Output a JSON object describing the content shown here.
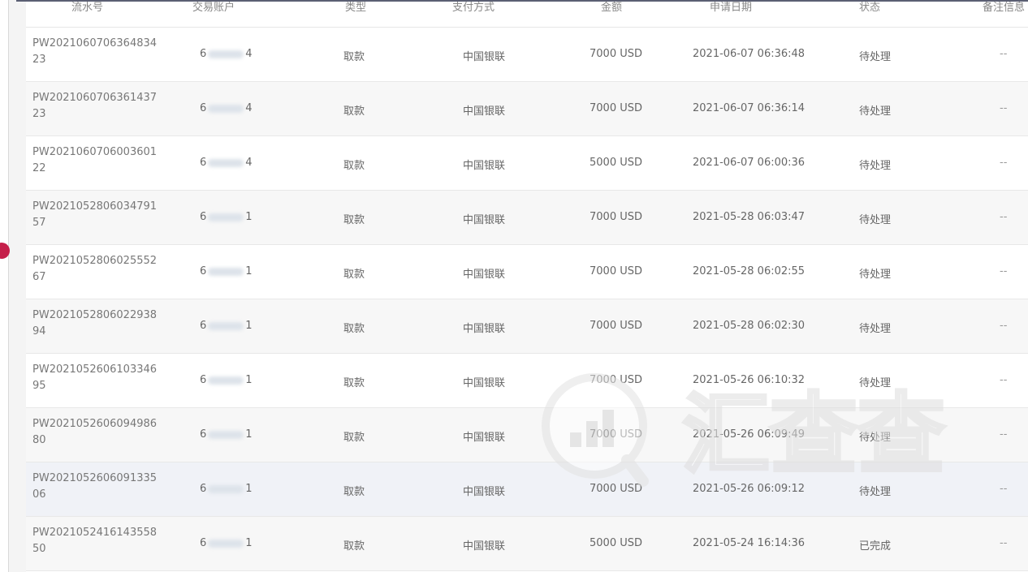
{
  "table": {
    "headers": [
      "流水号",
      "交易账户",
      "类型",
      "支付方式",
      "金额",
      "申请日期",
      "状态",
      "备注信息"
    ],
    "rows": [
      {
        "id": "PW202106070636483423",
        "acc_first": "6",
        "acc_last": "4",
        "type": "取款",
        "channel": "中国银联",
        "amount": "7000 USD",
        "time": "2021-06-07 06:36:48",
        "status": "待处理",
        "note": "--"
      },
      {
        "id": "PW202106070636143723",
        "acc_first": "6",
        "acc_last": "4",
        "type": "取款",
        "channel": "中国银联",
        "amount": "7000 USD",
        "time": "2021-06-07 06:36:14",
        "status": "待处理",
        "note": "--"
      },
      {
        "id": "PW202106070600360122",
        "acc_first": "6",
        "acc_last": "4",
        "type": "取款",
        "channel": "中国银联",
        "amount": "5000 USD",
        "time": "2021-06-07 06:00:36",
        "status": "待处理",
        "note": "--"
      },
      {
        "id": "PW202105280603479157",
        "acc_first": "6",
        "acc_last": "1",
        "type": "取款",
        "channel": "中国银联",
        "amount": "7000 USD",
        "time": "2021-05-28 06:03:47",
        "status": "待处理",
        "note": "--"
      },
      {
        "id": "PW202105280602555267",
        "acc_first": "6",
        "acc_last": "1",
        "type": "取款",
        "channel": "中国银联",
        "amount": "7000 USD",
        "time": "2021-05-28 06:02:55",
        "status": "待处理",
        "note": "--"
      },
      {
        "id": "PW202105280602293894",
        "acc_first": "6",
        "acc_last": "1",
        "type": "取款",
        "channel": "中国银联",
        "amount": "7000 USD",
        "time": "2021-05-28 06:02:30",
        "status": "待处理",
        "note": "--"
      },
      {
        "id": "PW202105260610334695",
        "acc_first": "6",
        "acc_last": "1",
        "type": "取款",
        "channel": "中国银联",
        "amount": "7000 USD",
        "time": "2021-05-26 06:10:32",
        "status": "待处理",
        "note": "--"
      },
      {
        "id": "PW202105260609498680",
        "acc_first": "6",
        "acc_last": "1",
        "type": "取款",
        "channel": "中国银联",
        "amount": "7000 USD",
        "time": "2021-05-26 06:09:49",
        "status": "待处理",
        "note": "--"
      },
      {
        "id": "PW202105260609133506",
        "acc_first": "6",
        "acc_last": "1",
        "type": "取款",
        "channel": "中国银联",
        "amount": "7000 USD",
        "time": "2021-05-26 06:09:12",
        "status": "待处理",
        "note": "--"
      },
      {
        "id": "PW202105241614355850",
        "acc_first": "6",
        "acc_last": "1",
        "type": "取款",
        "channel": "中国银联",
        "amount": "5000 USD",
        "time": "2021-05-24 16:14:36",
        "status": "已完成",
        "note": "--"
      }
    ]
  },
  "watermark": {
    "text": "汇查查",
    "icon": "bar-chart-magnifier-icon"
  },
  "colors": {
    "top_bar": "#5b5f73",
    "side_dot": "#c51f4a"
  }
}
